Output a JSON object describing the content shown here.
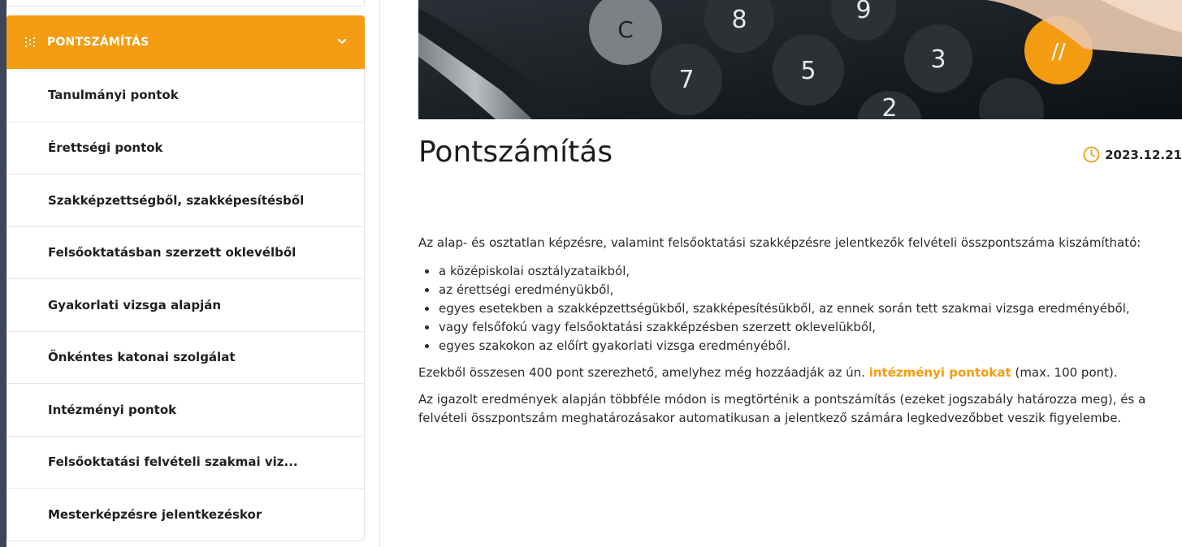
{
  "sidebar": {
    "section_title": "PONTSZÁMÍTÁS",
    "items": [
      {
        "label": "Tanulmányi pontok"
      },
      {
        "label": "Érettségi pontok"
      },
      {
        "label": "Szakképzettségből, szakképesítésből"
      },
      {
        "label": "Felsőoktatásban szerzett oklevélből"
      },
      {
        "label": "Gyakorlati vizsga alapján"
      },
      {
        "label": "Önkéntes katonai szolgálat"
      },
      {
        "label": "Intézményi pontok"
      },
      {
        "label": "Felsőoktatási felvételi szakmai viz..."
      },
      {
        "label": "Mesterképzésre jelentkezéskor"
      }
    ]
  },
  "hero": {
    "keys": [
      "C",
      "8",
      "9",
      "7",
      "5",
      "3",
      "2",
      "//"
    ]
  },
  "article": {
    "title": "Pontszámítás",
    "date": "2023.12.21",
    "intro": "Az alap- és osztatlan képzésre, valamint felsőoktatási szakképzésre jelentkezők felvételi összpontszáma kiszámítható:",
    "bullets": [
      "a középiskolai osztályzataikból,",
      "az érettségi eredményükből,",
      "egyes esetekben a szakképzettségükből, szakképesítésükből, az ennek során tett szakmai vizsga eredményéből,",
      "vagy felsőfokú vagy felsőoktatási szakképzésben szerzett oklevelükből,",
      "egyes szakokon az előírt gyakorlati vizsga eredményéből."
    ],
    "para2_before": "Ezekből összesen 400 pont szerezhető, amelyhez még hozzáadják az ún.",
    "para2_link": "intézményi pontokat",
    "para2_after": "(max. 100 pont).",
    "para3": "Az igazolt eredmények alapján többféle módon is megtörténik a pontszámítás (ezeket jogszabály határozza meg), és a felvételi összpontszám meghatározásakor automatikusan a jelentkező számára legkedvezőbbet veszik figyelembe."
  },
  "colors": {
    "accent": "#f39c12",
    "background_dark": "#3c4656"
  }
}
